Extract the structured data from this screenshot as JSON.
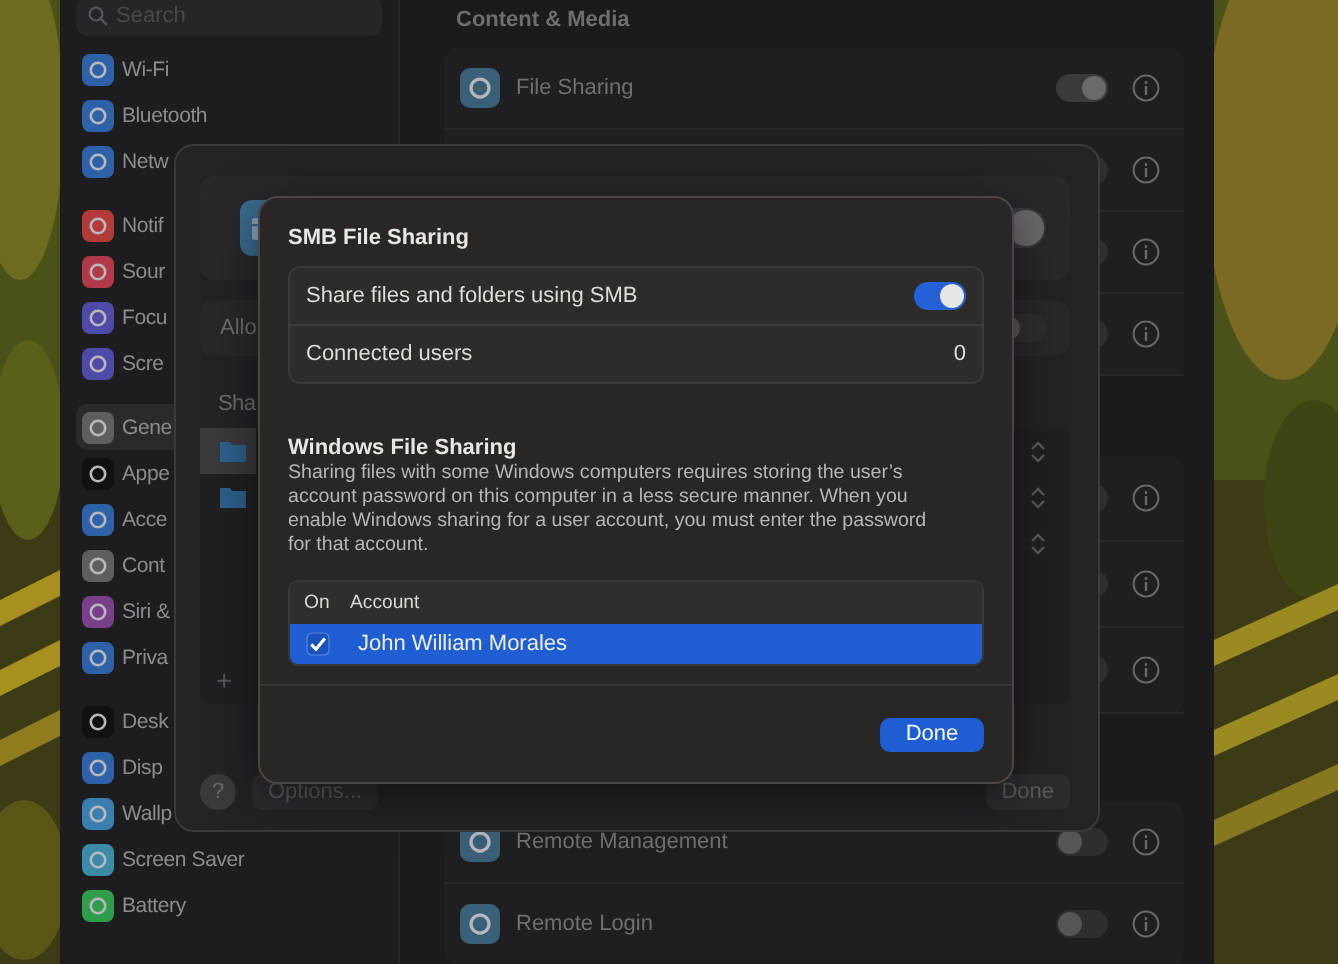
{
  "sidebar": {
    "search": {
      "placeholder": "Search"
    },
    "groups": [
      [
        {
          "label": "Wi-Fi",
          "color": "#2e62a8",
          "selected": false
        },
        {
          "label": "Bluetooth",
          "color": "#2e62a8",
          "selected": false
        },
        {
          "label": "Netw",
          "color": "#2e62a8",
          "selected": false
        }
      ],
      [
        {
          "label": "Notif",
          "color": "#b23a38",
          "selected": false
        },
        {
          "label": "Sour",
          "color": "#b23a48",
          "selected": false
        },
        {
          "label": "Focu",
          "color": "#4f4aa8",
          "selected": false
        },
        {
          "label": "Scre",
          "color": "#4f4aa8",
          "selected": false
        }
      ],
      [
        {
          "label": "Gene",
          "color": "#5e5e62",
          "selected": true
        },
        {
          "label": "Appe",
          "color": "#111113",
          "selected": false
        },
        {
          "label": "Acce",
          "color": "#2e62a8",
          "selected": false
        },
        {
          "label": "Cont",
          "color": "#5e5e62",
          "selected": false
        },
        {
          "label": "Siri &",
          "color": "#7a3f8a",
          "selected": false
        },
        {
          "label": "Priva",
          "color": "#2e62a8",
          "selected": false
        }
      ],
      [
        {
          "label": "Desk",
          "color": "#111113",
          "selected": false
        },
        {
          "label": "Disp",
          "color": "#2e62a8",
          "selected": false
        },
        {
          "label": "Wallp",
          "color": "#3a7fb0",
          "selected": false
        },
        {
          "label": "Screen Saver",
          "color": "#3a8aa8",
          "selected": false
        },
        {
          "label": "Battery",
          "color": "#2f9e4a",
          "selected": false
        }
      ]
    ]
  },
  "content": {
    "heading": "Content & Media",
    "groups": [
      {
        "rows": [
          {
            "label": "File Sharing",
            "on": true
          },
          {
            "on": false
          },
          {
            "on": false
          },
          {
            "on": false
          }
        ]
      },
      {
        "rows": [
          {
            "on": false
          },
          {
            "on": false
          },
          {
            "on": false
          }
        ]
      },
      {
        "rows": [
          {
            "label": "Remote Management",
            "on": false
          },
          {
            "label": "Remote Login",
            "on": false
          }
        ]
      }
    ]
  },
  "file_sharing_sheet": {
    "service_on": true,
    "allow_label": "Allo",
    "allow_on": false,
    "shared_heading": "Sha",
    "shared_rows": [
      {
        "kind": "folder",
        "selected": true
      },
      {
        "kind": "folder",
        "selected": false
      },
      {
        "kind": "blank",
        "selected": false
      }
    ],
    "add_label": "+",
    "help_label": "?",
    "options_button": "Options...",
    "done_button": "Done"
  },
  "smb_sheet": {
    "title": "SMB File Sharing",
    "share_label": "Share files and folders using SMB",
    "share_on": true,
    "connected_label": "Connected users",
    "connected_count": "0",
    "windows_title": "Windows File Sharing",
    "windows_description": "Sharing files with some Windows computers requires storing the user’s account password on this computer in a less secure manner. When you enable Windows sharing for a user account, you must enter the password for that account.",
    "columns": [
      "On",
      "Account"
    ],
    "accounts": [
      {
        "name": "John William Morales",
        "on": true,
        "selected": true
      }
    ],
    "done_button": "Done"
  }
}
